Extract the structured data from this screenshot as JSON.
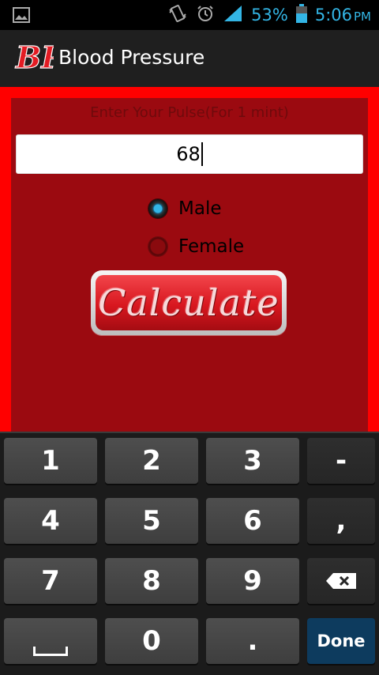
{
  "status_bar": {
    "battery": "53%",
    "time": "5:06",
    "time_suffix": "PM",
    "icons": [
      "image-icon",
      "vibrate-icon",
      "alarm-icon",
      "signal-icon",
      "battery-icon"
    ],
    "accent_color": "#33b5e5"
  },
  "app": {
    "title": "Blood Pressure",
    "logo_text": "BP"
  },
  "form": {
    "prompt": "Enter Your Pulse(For 1 mint)",
    "pulse_value": "68",
    "gender_options": [
      {
        "label": "Male",
        "checked": true
      },
      {
        "label": "Female",
        "checked": false
      }
    ],
    "calculate_label": "Calculate"
  },
  "keyboard": {
    "rows": [
      [
        "1",
        "2",
        "3",
        "-"
      ],
      [
        "4",
        "5",
        "6",
        ","
      ],
      [
        "7",
        "8",
        "9",
        "backspace"
      ],
      [
        "space",
        "0",
        ".",
        "Done"
      ]
    ],
    "done_label": "Done"
  },
  "colors": {
    "frame": "#ff0000",
    "panel": "#9b0a10",
    "done_key": "#0d3b5e"
  }
}
